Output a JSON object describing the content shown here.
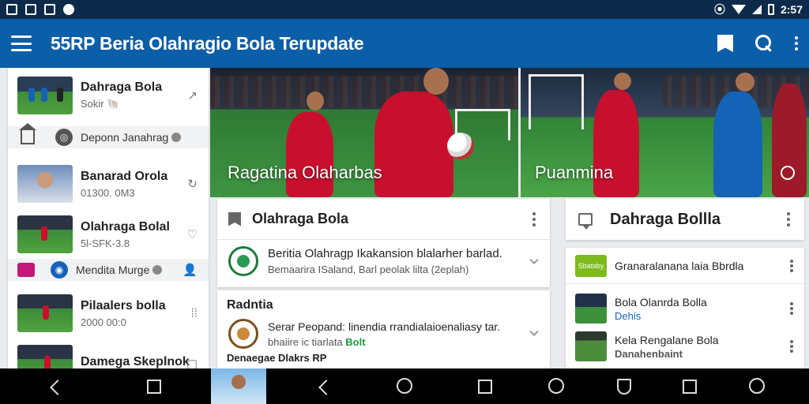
{
  "status_bar": {
    "time": "2:57"
  },
  "app_bar": {
    "title": "55RP Beria Olahragio Bola Terupdate"
  },
  "sidebar": {
    "items": [
      {
        "title": "Dahraga Bola",
        "subtitle": "Sokir 🐚"
      },
      {
        "label": "Deponn Janahrag"
      },
      {
        "title": "Banarad Orola",
        "subtitle": "01300. 0M3"
      },
      {
        "title": "Olahraga Bolal",
        "subtitle": "5l-SFK-3.8"
      },
      {
        "label": "Mendita Murge"
      },
      {
        "title": "Pilaalers bolla",
        "subtitle": "2000 00:0"
      },
      {
        "title": "Damega Skeplnok",
        "subtitle": ""
      }
    ]
  },
  "banners": [
    {
      "caption": "Ragatina Olaharbas"
    },
    {
      "caption": "Puanmina"
    }
  ],
  "feed_card": {
    "title": "Olahraga Bola",
    "row": {
      "title": "Beritia Olahragp Ikakansion blalarher barlad.",
      "subtitle": "Bemaarira ISaland, Barl peolak lilta (2eplah)"
    }
  },
  "featured_card": {
    "section_title": "Radntia",
    "row_text": "Serar Peopand: linendia rrandialaioenaliasy tar.",
    "row_text2_prefix": "bhaiire ic tiarlata ",
    "row_text2_highlight": "Bolt",
    "footer": "Denaegae Dlakrs RP"
  },
  "right_header": {
    "title": "Dahraga Bollla"
  },
  "right_list": {
    "promo": {
      "chip_label": "Sbatsby",
      "title": "Granaralanana laia Bbrdla"
    },
    "items": [
      {
        "title": "Bola Olanrda Bolla",
        "subtitle": "Dehis"
      },
      {
        "title": "Kela Rengalane Bola",
        "subtitle": "Danahenbaint"
      }
    ]
  },
  "colors": {
    "app_bar": "#0b5ea8",
    "status_bar": "#0d2a4a",
    "accent_green": "#1f9a3d",
    "kit_red": "#c8102e",
    "kit_blue": "#1463b6"
  }
}
